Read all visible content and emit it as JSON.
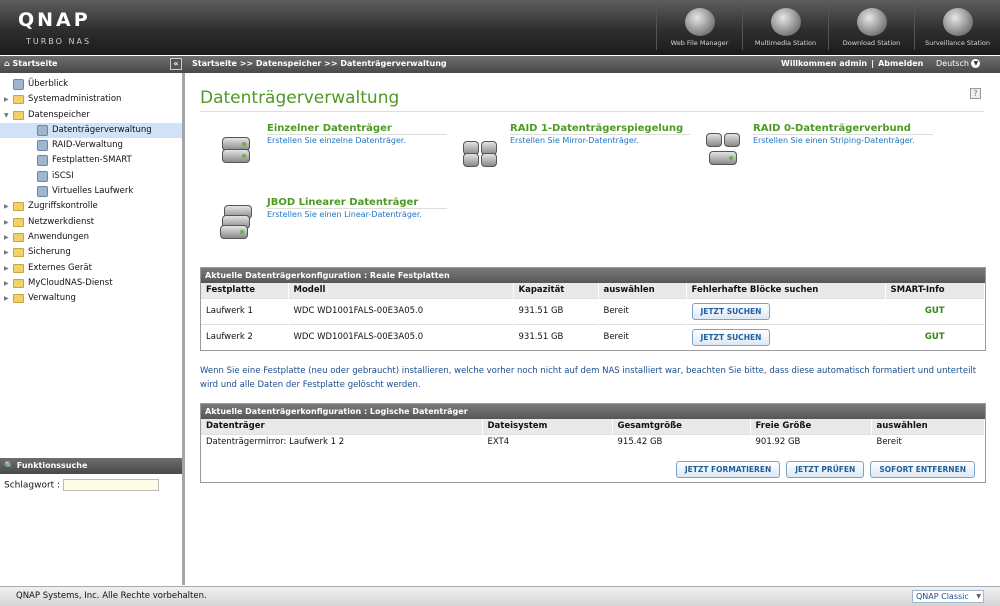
{
  "header": {
    "logo": "QNAP",
    "logo_sub": "TURBO NAS",
    "apps": [
      {
        "label": "Web File Manager",
        "icon": "folder-globe-icon"
      },
      {
        "label": "Multimedia Station",
        "icon": "film-icon"
      },
      {
        "label": "Download Station",
        "icon": "download-icon"
      },
      {
        "label": "Surveillance Station",
        "icon": "camera-icon"
      }
    ]
  },
  "navbar": {
    "home": "Startseite",
    "breadcrumb": "Startseite >> Datenspeicher >> Datenträgerverwaltung",
    "welcome": "Willkommen admin",
    "logout": "Abmelden",
    "language": "Deutsch"
  },
  "sidebar": {
    "items": [
      {
        "label": "Überblick",
        "level": 0,
        "type": "leaf",
        "icon": "overview-icon"
      },
      {
        "label": "Systemadministration",
        "level": 0,
        "type": "folder",
        "expanded": false
      },
      {
        "label": "Datenspeicher",
        "level": 0,
        "type": "folder",
        "expanded": true
      },
      {
        "label": "Datenträgerverwaltung",
        "level": 1,
        "type": "leaf",
        "active": true,
        "icon": "disk-icon"
      },
      {
        "label": "RAID-Verwaltung",
        "level": 1,
        "type": "leaf",
        "icon": "raid-icon"
      },
      {
        "label": "Festplatten-SMART",
        "level": 1,
        "type": "leaf",
        "icon": "smart-icon"
      },
      {
        "label": "iSCSI",
        "level": 1,
        "type": "leaf",
        "icon": "iscsi-icon"
      },
      {
        "label": "Virtuelles Laufwerk",
        "level": 1,
        "type": "leaf",
        "icon": "virtual-drive-icon"
      },
      {
        "label": "Zugriffskontrolle",
        "level": 0,
        "type": "folder",
        "expanded": false
      },
      {
        "label": "Netzwerkdienst",
        "level": 0,
        "type": "folder",
        "expanded": false
      },
      {
        "label": "Anwendungen",
        "level": 0,
        "type": "folder",
        "expanded": false
      },
      {
        "label": "Sicherung",
        "level": 0,
        "type": "folder",
        "expanded": false
      },
      {
        "label": "Externes Gerät",
        "level": 0,
        "type": "folder",
        "expanded": false
      },
      {
        "label": "MyCloudNAS-Dienst",
        "level": 0,
        "type": "folder",
        "expanded": false
      },
      {
        "label": "Verwaltung",
        "level": 0,
        "type": "folder",
        "expanded": false
      }
    ]
  },
  "search": {
    "title": "Funktionssuche",
    "keyword_label": "Schlagwort :",
    "value": ""
  },
  "main": {
    "title": "Datenträgerverwaltung",
    "options": [
      {
        "title": "Einzelner Datenträger",
        "subtitle": "Erstellen Sie einzelne Datenträger."
      },
      {
        "title": "RAID 1-Datenträgerspiegelung",
        "subtitle": "Erstellen Sie Mirror-Datenträger."
      },
      {
        "title": "RAID 0-Datenträgerverbund",
        "subtitle": "Erstellen Sie einen Striping-Datenträger."
      },
      {
        "title": "JBOD Linearer Datenträger",
        "subtitle": "Erstellen Sie einen Linear-Datenträger."
      }
    ],
    "physical": {
      "title": "Aktuelle Datenträgerkonfiguration : Reale Festplatten",
      "headers": [
        "Festplatte",
        "Modell",
        "Kapazität",
        "auswählen",
        "Fehlerhafte Blöcke suchen",
        "SMART-Info"
      ],
      "rows": [
        {
          "disk": "Laufwerk 1",
          "model": "WDC WD1001FALS-00E3A05.0",
          "capacity": "931.51 GB",
          "status": "Bereit",
          "button": "JETZT SUCHEN",
          "smart": "GUT"
        },
        {
          "disk": "Laufwerk 2",
          "model": "WDC WD1001FALS-00E3A05.0",
          "capacity": "931.51 GB",
          "status": "Bereit",
          "button": "JETZT SUCHEN",
          "smart": "GUT"
        }
      ]
    },
    "note": "Wenn Sie eine Festplatte (neu oder gebraucht) installieren, welche vorher noch nicht auf dem NAS installiert war, beachten Sie bitte, dass diese automatisch formatiert und unterteilt wird und alle Daten der Festplatte gelöscht werden.",
    "logical": {
      "title": "Aktuelle Datenträgerkonfiguration : Logische Datenträger",
      "headers": [
        "Datenträger",
        "Dateisystem",
        "Gesamtgröße",
        "Freie Größe",
        "auswählen"
      ],
      "rows": [
        {
          "volume": "Datenträgermirror: Laufwerk 1 2",
          "fs": "EXT4",
          "total": "915.42 GB",
          "free": "901.92 GB",
          "status": "Bereit"
        }
      ],
      "buttons": [
        "JETZT FORMATIEREN",
        "JETZT PRÜFEN",
        "SOFORT ENTFERNEN"
      ]
    }
  },
  "footer": {
    "copyright": "QNAP Systems, Inc. Alle Rechte vorbehalten.",
    "theme": "QNAP Classic"
  }
}
